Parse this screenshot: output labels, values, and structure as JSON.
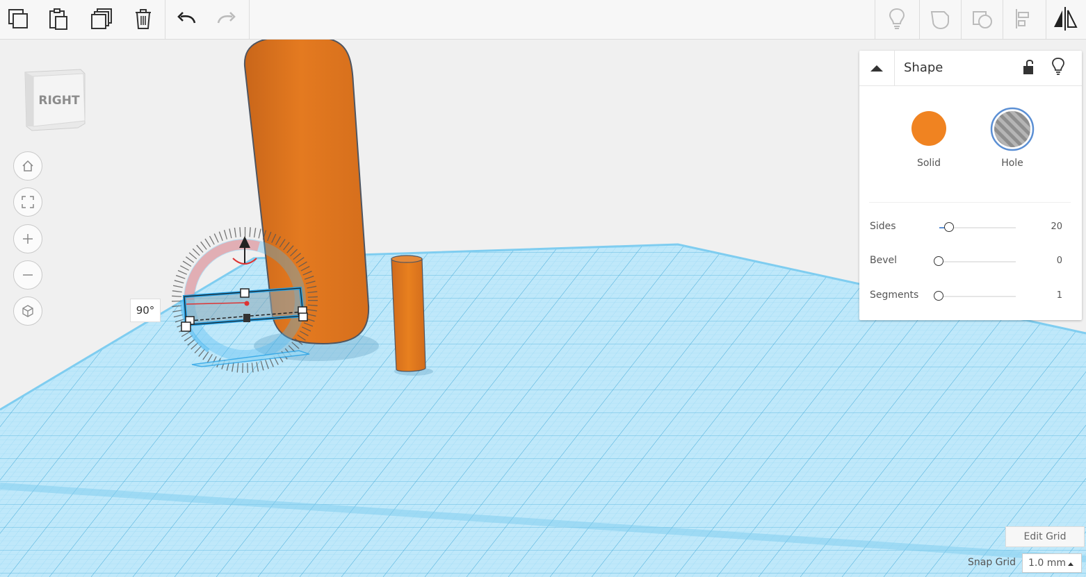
{
  "toolbar": {
    "left_icons": [
      "copy-icon",
      "paste-icon",
      "duplicate-icon",
      "delete-icon",
      "undo-icon",
      "redo-icon"
    ],
    "right_icons": [
      "note-icon",
      "group-icon",
      "ungroup-icon",
      "align-icon",
      "mirror-icon"
    ]
  },
  "viewcube": {
    "face_label": "RIGHT"
  },
  "nav_controls": [
    "home-view-icon",
    "fit-all-icon",
    "zoom-in-icon",
    "zoom-out-icon",
    "perspective-icon"
  ],
  "rotation": {
    "angle_label": "90°"
  },
  "shape_panel": {
    "title": "Shape",
    "solid_label": "Solid",
    "hole_label": "Hole",
    "solid_color": "#f08321",
    "sliders": [
      {
        "label": "Sides",
        "value": "20",
        "fraction": 0.12
      },
      {
        "label": "Bevel",
        "value": "0",
        "fraction": 0.0
      },
      {
        "label": "Segments",
        "value": "1",
        "fraction": 0.0
      }
    ]
  },
  "footer": {
    "edit_grid_label": "Edit Grid",
    "snap_grid_label": "Snap Grid",
    "snap_grid_value": "1.0 mm"
  },
  "colors": {
    "accent_orange": "#e87d25",
    "workplane_blue": "#5cc0ec",
    "selection_blue": "#1f9be0"
  }
}
